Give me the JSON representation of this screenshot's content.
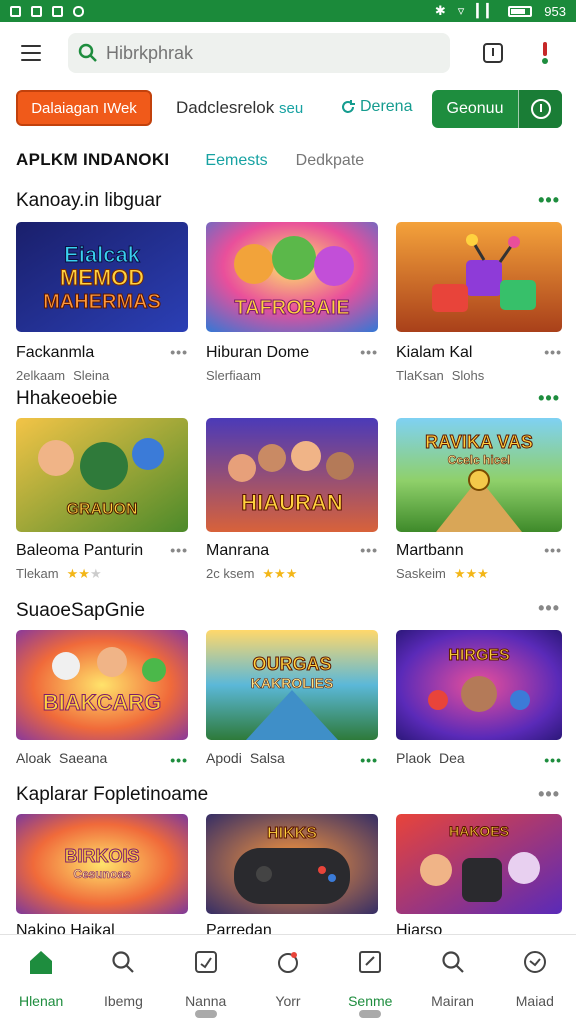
{
  "status": {
    "time": "953"
  },
  "search": {
    "placeholder": "Hibrkphrak"
  },
  "chips": {
    "primary": "Dalaiagan IWek",
    "text_main": "Dadclesrelok",
    "text_accent": "seu",
    "link": "Derena",
    "green_button": "Geonuu"
  },
  "tabs": {
    "heading": "APLKM INDANOKI",
    "tab1": "Eemests",
    "tab2": "Dedkpate"
  },
  "sections": [
    {
      "title": "Kanoay.in libguar",
      "cards": [
        {
          "name": "Fackanmla",
          "meta1": "2elkaam",
          "meta2": "Sleina",
          "thumb_text": [
            "Eialcak",
            "MEMOD",
            "MAHERMAS"
          ]
        },
        {
          "name": "Hiburan Dome",
          "meta1": "Slerfiaam",
          "meta2": "",
          "thumb_text": [
            "TAFROBAIE"
          ]
        },
        {
          "name": "Kialam Kal",
          "meta1": "TlaKsan",
          "meta2": "Slohs",
          "thumb_text": []
        }
      ]
    },
    {
      "title": "Hhakeoebie",
      "cards": [
        {
          "name": "Baleoma Panturin",
          "meta1": "Tlekam",
          "rating": 2,
          "thumb_text": [
            "GRAUON"
          ]
        },
        {
          "name": "Manrana",
          "meta1": "2c ksem",
          "rating": 3,
          "thumb_text": [
            "HIAURAN"
          ]
        },
        {
          "name": "Martbann",
          "meta1": "Saskeim",
          "rating": 3,
          "thumb_text": [
            "RAVIKA VAS",
            "Ccelc hicel"
          ]
        }
      ]
    },
    {
      "title": "SuaoeSapGnie",
      "cards": [
        {
          "name": "",
          "meta1": "Aloak",
          "meta2": "Saeana",
          "thumb_text": [
            "BIAKCARG"
          ]
        },
        {
          "name": "",
          "meta1": "Apodi",
          "meta2": "Salsa",
          "thumb_text": [
            "OURGAS",
            "KAKROLIES"
          ]
        },
        {
          "name": "",
          "meta1": "Plaok",
          "meta2": "Dea",
          "thumb_text": [
            "HIRGES"
          ]
        }
      ]
    },
    {
      "title": "Kaplarar Fopletinoame",
      "cards": [
        {
          "name": "Nakino Haikal",
          "thumb_text": [
            "BIRKOIS",
            "Cesunoas"
          ]
        },
        {
          "name": "Parredan",
          "thumb_text": [
            "HIKKS"
          ]
        },
        {
          "name": "Hiarso",
          "thumb_text": [
            "HAKOES"
          ]
        }
      ]
    }
  ],
  "nav": [
    {
      "label": "Hlenan",
      "icon": "home-icon"
    },
    {
      "label": "Ibemg",
      "icon": "search-icon"
    },
    {
      "label": "Nanna",
      "icon": "card-icon"
    },
    {
      "label": "Yorr",
      "icon": "timer-icon"
    },
    {
      "label": "Senme",
      "icon": "note-icon"
    },
    {
      "label": "Mairan",
      "icon": "search-icon"
    },
    {
      "label": "Maiad",
      "icon": "clock-icon"
    }
  ],
  "colors": {
    "brand_green": "#1e8d3e",
    "status_green": "#1b8a3a",
    "accent_orange": "#f05a1a",
    "teal": "#17a2a2"
  }
}
